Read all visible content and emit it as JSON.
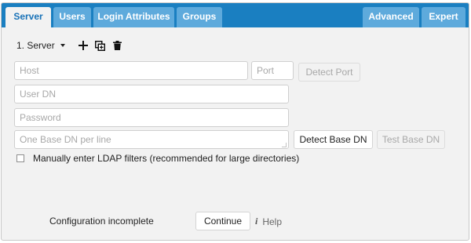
{
  "tabs": {
    "server": "Server",
    "users": "Users",
    "login_attributes": "Login Attributes",
    "groups": "Groups",
    "advanced": "Advanced",
    "expert": "Expert"
  },
  "toolbar": {
    "server_select_value": "1. Server",
    "icons": [
      "plus-icon",
      "copy-icon",
      "trash-icon"
    ]
  },
  "fields": {
    "host_placeholder": "Host",
    "port_placeholder": "Port",
    "user_dn_placeholder": "User DN",
    "password_placeholder": "Password",
    "base_dn_placeholder": "One Base DN per line"
  },
  "buttons": {
    "detect_port": "Detect Port",
    "detect_base_dn": "Detect Base DN",
    "test_base_dn": "Test Base DN",
    "continue": "Continue"
  },
  "checkbox": {
    "label": "Manually enter LDAP filters (recommended for large directories)",
    "checked": false
  },
  "footer": {
    "status": "Configuration incomplete",
    "help": "Help"
  },
  "colors": {
    "tab_bar": "#1a7fc1",
    "tab_inactive": "#5eaadc",
    "tab_active_text": "#1a73b8",
    "panel_bg": "#f2f2f2"
  }
}
